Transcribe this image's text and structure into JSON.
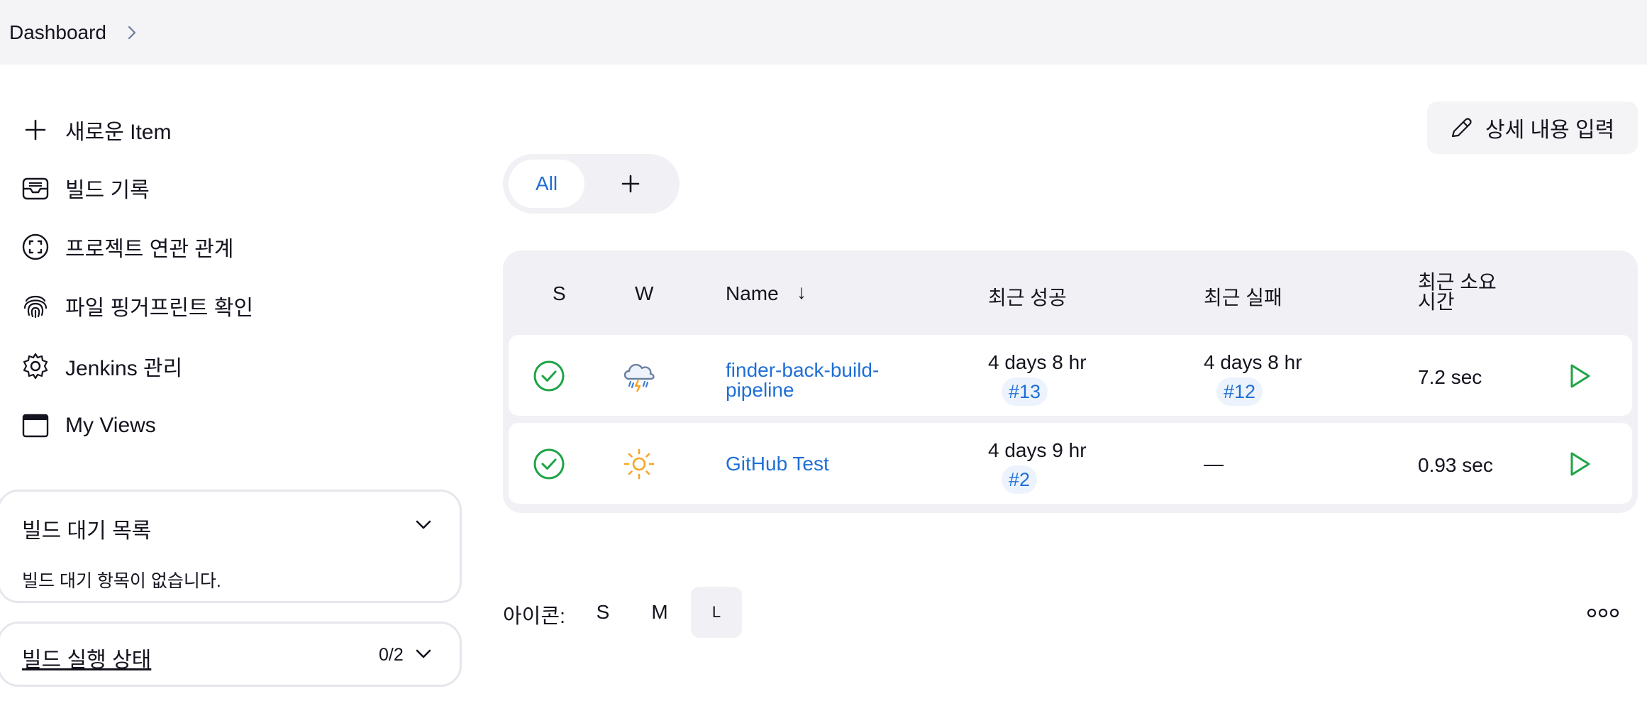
{
  "breadcrumb": {
    "items": [
      "Dashboard"
    ]
  },
  "sidebar": {
    "items": [
      {
        "label": "새로운 Item",
        "icon": "plus-icon"
      },
      {
        "label": "빌드 기록",
        "icon": "inbox-icon"
      },
      {
        "label": "프로젝트 연관 관계",
        "icon": "relationship-icon"
      },
      {
        "label": "파일 핑거프린트 확인",
        "icon": "fingerprint-icon"
      },
      {
        "label": "Jenkins 관리",
        "icon": "gear-icon"
      },
      {
        "label": "My Views",
        "icon": "window-icon"
      }
    ],
    "build_queue": {
      "title": "빌드 대기 목록",
      "empty_text": "빌드 대기 항목이 없습니다."
    },
    "executor_status": {
      "title": "빌드 실행 상태",
      "count": "0/2"
    }
  },
  "header": {
    "edit_description_label": "상세 내용 입력"
  },
  "tabs": {
    "all_label": "All"
  },
  "table": {
    "headers": {
      "status": "S",
      "weather": "W",
      "name": "Name",
      "sort_arrow": "↓",
      "last_success": "최근 성공",
      "last_failure": "최근 실패",
      "last_duration_line1": "최근 소요",
      "last_duration_line2": "시간"
    },
    "rows": [
      {
        "status": "success",
        "weather": "thunderstorm",
        "name_line1": "finder-back-build-",
        "name_line2": "pipeline",
        "last_success": "4 days 8 hr",
        "last_success_build": "#13",
        "last_failure": "4 days 8 hr",
        "last_failure_build": "#12",
        "duration": "7.2 sec"
      },
      {
        "status": "success",
        "weather": "sunny",
        "name_line1": "GitHub Test",
        "name_line2": "",
        "last_success": "4 days 9 hr",
        "last_success_build": "#2",
        "last_failure": "—",
        "last_failure_build": "",
        "duration": "0.93 sec"
      }
    ]
  },
  "footer": {
    "icon_label": "아이콘:",
    "sizes": [
      "S",
      "M",
      "L"
    ],
    "active_size": "L"
  },
  "colors": {
    "accent": "#1f6fd6",
    "success": "#1ea446",
    "sun": "#f6a623",
    "background_bar": "#f4f4f7"
  }
}
